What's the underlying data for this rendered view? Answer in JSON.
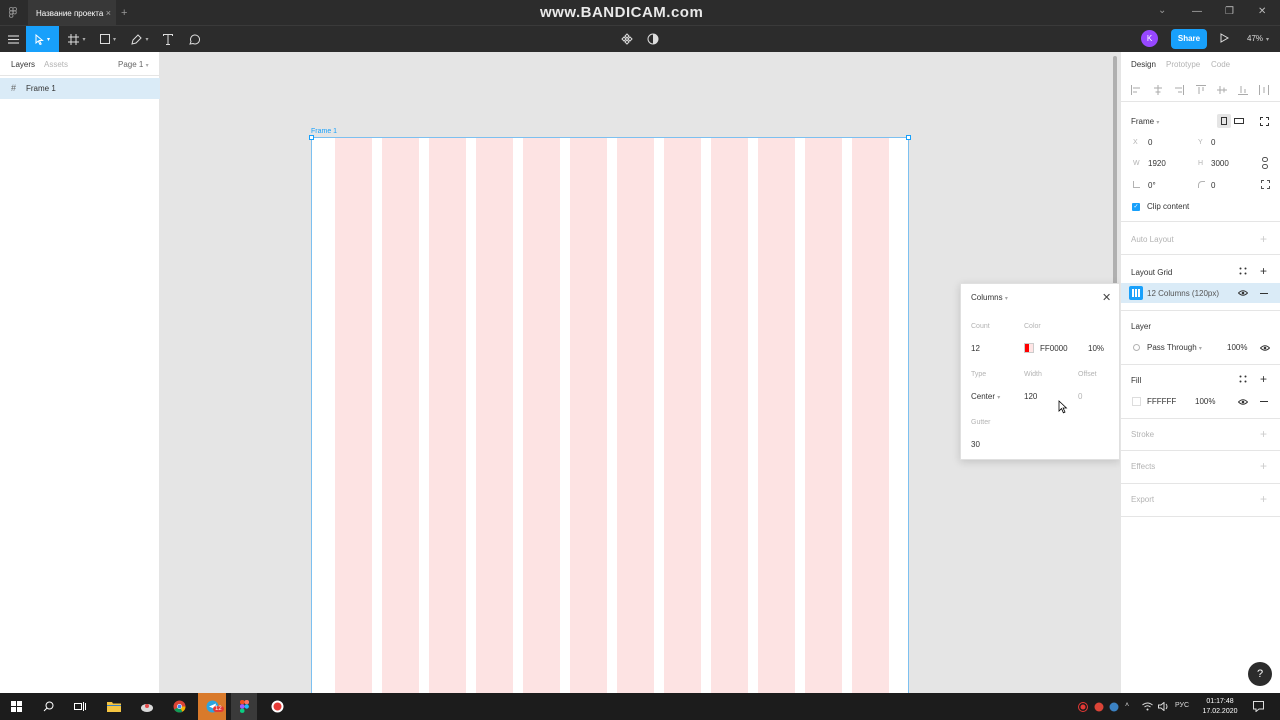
{
  "titlebar": {
    "tab_title": "Название проекта",
    "tab_close": "×",
    "new_tab": "+",
    "watermark": "www.BANDICAM.com",
    "chevron": "⌄",
    "minimize": "—",
    "restore": "❐",
    "close": "✕"
  },
  "toolbar": {
    "tools": [
      "menu-icon",
      "move-tool",
      "frame-tool",
      "shape-tool",
      "pen-tool",
      "text-tool",
      "comment-tool"
    ],
    "center_icons": [
      "components-icon",
      "contrast-icon"
    ],
    "avatar_letter": "K",
    "share_label": "Share",
    "zoom": "47%"
  },
  "left_panel": {
    "tabs": [
      "Layers",
      "Assets"
    ],
    "page_selector": "Page 1",
    "layers": [
      {
        "name": "Frame 1",
        "icon": "frame-icon"
      }
    ]
  },
  "canvas": {
    "frame_label": "Frame 1",
    "column_count": 12,
    "column_color": "#FF0000",
    "column_opacity": "10%"
  },
  "grid_popup": {
    "title": "Columns",
    "count_label": "Count",
    "count": "12",
    "color_label": "Color",
    "color_hex": "FF0000",
    "color_opacity": "10%",
    "type_label": "Type",
    "type": "Center",
    "width_label": "Width",
    "width": "120",
    "offset_label": "Offset",
    "offset": "0",
    "gutter_label": "Gutter",
    "gutter": "30"
  },
  "right_panel": {
    "tabs": [
      "Design",
      "Prototype",
      "Code"
    ],
    "frame_label": "Frame",
    "x_label": "X",
    "x": "0",
    "y_label": "Y",
    "y": "0",
    "w_label": "W",
    "w": "1920",
    "h_label": "H",
    "h": "3000",
    "rotation": "0°",
    "radius": "0",
    "clip_content": "Clip content",
    "auto_layout": "Auto Layout",
    "layout_grid": "Layout Grid",
    "grid_item": "12 Columns (120px)",
    "layer": "Layer",
    "blend_mode": "Pass Through",
    "layer_opacity": "100%",
    "fill": "Fill",
    "fill_hex": "FFFFFF",
    "fill_opacity": "100%",
    "stroke": "Stroke",
    "effects": "Effects",
    "export": "Export",
    "help": "?"
  },
  "taskbar": {
    "lang": "РУС",
    "time": "01:17:48",
    "date": "17.02.2020",
    "badge": "12"
  }
}
